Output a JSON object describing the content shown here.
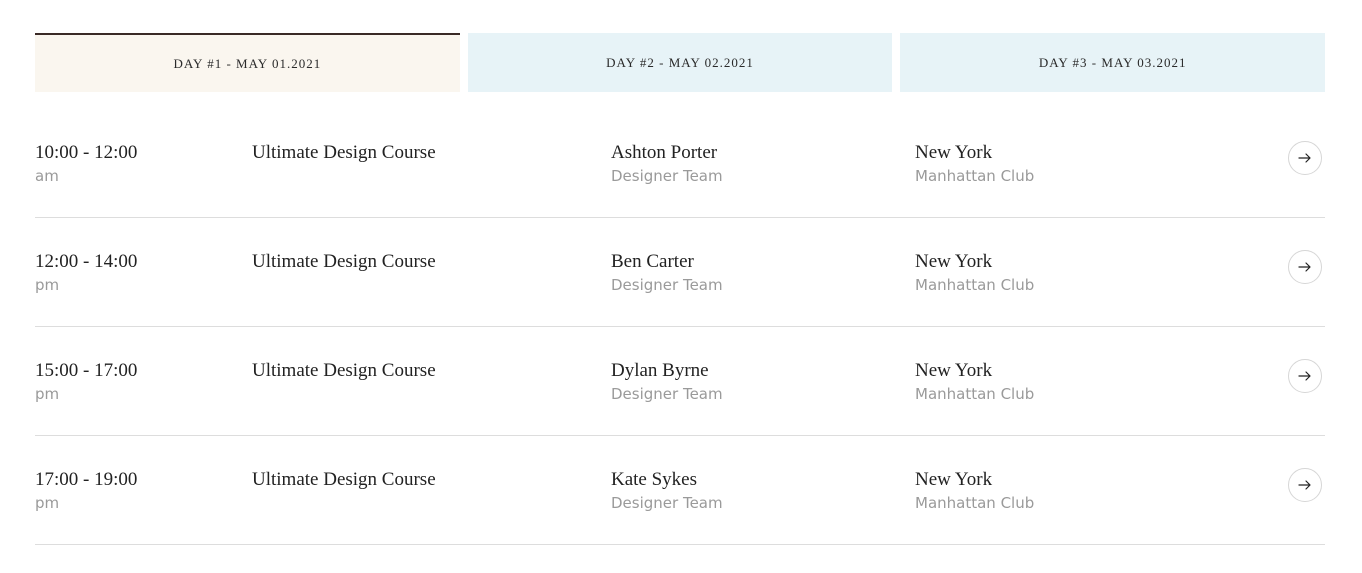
{
  "tabs": [
    {
      "label": "DAY #1 - MAY 01.2021",
      "active": true
    },
    {
      "label": "DAY #2 - MAY 02.2021",
      "active": false
    },
    {
      "label": "DAY #3 - MAY 03.2021",
      "active": false
    }
  ],
  "sessions": [
    {
      "time": "10:00 - 12:00",
      "period": "am",
      "course": "Ultimate Design Course",
      "speaker": "Ashton Porter",
      "team": "Designer Team",
      "city": "New York",
      "venue": "Manhattan Club"
    },
    {
      "time": "12:00 - 14:00",
      "period": "pm",
      "course": "Ultimate Design Course",
      "speaker": "Ben Carter",
      "team": "Designer Team",
      "city": "New York",
      "venue": "Manhattan Club"
    },
    {
      "time": "15:00 - 17:00",
      "period": "pm",
      "course": "Ultimate Design Course",
      "speaker": "Dylan Byrne",
      "team": "Designer Team",
      "city": "New York",
      "venue": "Manhattan Club"
    },
    {
      "time": "17:00 - 19:00",
      "period": "pm",
      "course": "Ultimate Design Course",
      "speaker": "Kate Sykes",
      "team": "Designer Team",
      "city": "New York",
      "venue": "Manhattan Club"
    }
  ],
  "icons": {
    "row_action": "arrow-right-icon"
  },
  "colors": {
    "active_tab_bg": "#faf6ef",
    "active_tab_border": "#3a2a26",
    "inactive_tab_bg": "#e7f3f7",
    "secondary_text": "#9a9a9a",
    "divider": "#dddddd"
  }
}
